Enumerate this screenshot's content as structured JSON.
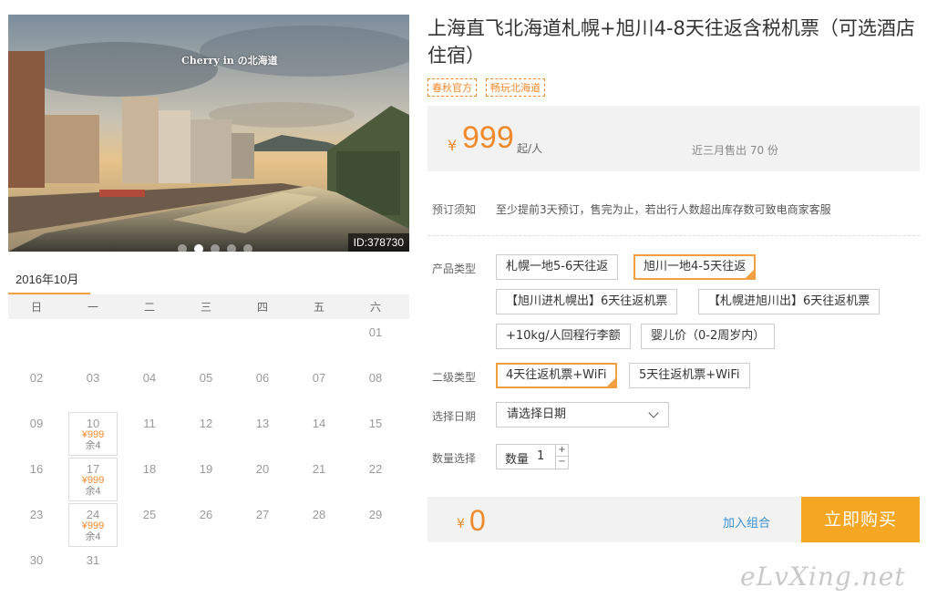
{
  "photo": {
    "id_label": "ID:378730",
    "watermark": "Cherry in の北海道",
    "slide_count": 5,
    "active_slide": 1
  },
  "calendar": {
    "month_tab": "2016年10月",
    "weekdays": [
      "日",
      "一",
      "二",
      "三",
      "四",
      "五",
      "六"
    ],
    "leading_blanks": 6,
    "days": [
      {
        "day": "01"
      },
      {
        "day": "02"
      },
      {
        "day": "03"
      },
      {
        "day": "04"
      },
      {
        "day": "05"
      },
      {
        "day": "06"
      },
      {
        "day": "07"
      },
      {
        "day": "08"
      },
      {
        "day": "09"
      },
      {
        "day": "10",
        "price": "¥999",
        "stock": "余4"
      },
      {
        "day": "11"
      },
      {
        "day": "12"
      },
      {
        "day": "13"
      },
      {
        "day": "14"
      },
      {
        "day": "15"
      },
      {
        "day": "16"
      },
      {
        "day": "17",
        "price": "¥999",
        "stock": "余4"
      },
      {
        "day": "18"
      },
      {
        "day": "19"
      },
      {
        "day": "20"
      },
      {
        "day": "21"
      },
      {
        "day": "22"
      },
      {
        "day": "23"
      },
      {
        "day": "24",
        "price": "¥999",
        "stock": "余4"
      },
      {
        "day": "25"
      },
      {
        "day": "26"
      },
      {
        "day": "27"
      },
      {
        "day": "28"
      },
      {
        "day": "29"
      },
      {
        "day": "30"
      },
      {
        "day": "31"
      }
    ]
  },
  "product": {
    "title": "上海直飞北海道札幌+旭川4-8天往返含税机票（可选酒店住宿）",
    "tags": [
      "春秋官方",
      "畅玩北海道"
    ],
    "price_symbol": "¥",
    "price": "999",
    "price_unit": "起/人",
    "sold": "近三月售出 70 份"
  },
  "booking": {
    "notice_label": "预订须知",
    "notice_text": "至少提前3天预订，售完为止，若出行人数超出库存数可致电商家客服",
    "type_label": "产品类型",
    "types": [
      {
        "label": "札幌一地5-6天往返",
        "selected": false
      },
      {
        "label": "旭川一地4-5天往返",
        "selected": true
      },
      {
        "label": "【旭川进札幌出】6天往返机票",
        "selected": false
      },
      {
        "label": "【札幌进旭川出】6天往返机票",
        "selected": false
      },
      {
        "label": "+10kg/人回程行李额",
        "selected": false
      },
      {
        "label": "婴儿价（0-2周岁内）",
        "selected": false
      }
    ],
    "subtype_label": "二级类型",
    "subtypes": [
      {
        "label": "4天往返机票+WiFi",
        "selected": true
      },
      {
        "label": "5天往返机票+WiFi",
        "selected": false
      }
    ],
    "date_label": "选择日期",
    "date_value": "请选择日期",
    "qty_label": "数量选择",
    "qty_field_label": "数量",
    "qty_value": "1",
    "qty_plus": "+",
    "qty_minus": "−",
    "total_symbol": "¥",
    "total": "0",
    "add_combo": "加入组合",
    "buy_now": "立即购买"
  },
  "site_watermark": "eLvXing.net",
  "colors": {
    "accent": "#f08a2c",
    "buy_button": "#f5a623",
    "selected_border": "#f0a040",
    "link": "#3a8fd0"
  }
}
